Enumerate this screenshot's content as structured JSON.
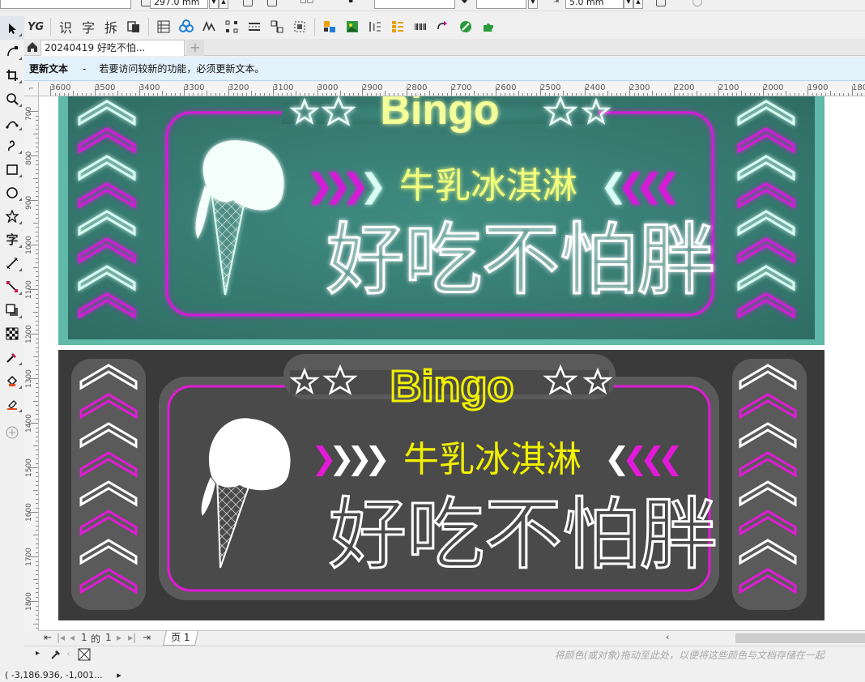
{
  "propbar": {
    "width_value": "297.0 mm",
    "nudge_value": "5.0 mm"
  },
  "toolbar": {
    "yg_label": "YG",
    "recognize_label": "识",
    "char_label": "字",
    "split_label": "拆"
  },
  "tools": [
    {
      "name": "pick-tool",
      "icon": "arrow-icon"
    },
    {
      "name": "shape-tool",
      "icon": "shape-icon"
    },
    {
      "name": "crop-tool",
      "icon": "crop-icon"
    },
    {
      "name": "zoom-tool",
      "icon": "magnifier-icon"
    },
    {
      "name": "freehand-tool",
      "icon": "freehand-icon"
    },
    {
      "name": "artistic-media-tool",
      "icon": "brush-icon"
    },
    {
      "name": "rectangle-tool",
      "icon": "rectangle-icon"
    },
    {
      "name": "ellipse-tool",
      "icon": "ellipse-icon"
    },
    {
      "name": "polygon-tool",
      "icon": "star-icon"
    },
    {
      "name": "text-tool",
      "icon": "text-icon",
      "label": "字"
    },
    {
      "name": "parallel-dimension-tool",
      "icon": "dimension-icon"
    },
    {
      "name": "connector-tool",
      "icon": "connector-icon"
    },
    {
      "name": "drop-shadow-tool",
      "icon": "shadow-icon"
    },
    {
      "name": "transparency-tool",
      "icon": "checker-icon"
    },
    {
      "name": "color-eyedropper-tool",
      "icon": "eyedropper-icon"
    },
    {
      "name": "interactive-fill-tool",
      "icon": "bucket-icon"
    },
    {
      "name": "smart-fill-tool",
      "icon": "smart-fill-icon"
    },
    {
      "name": "add-tool",
      "icon": "plus-circle-icon"
    }
  ],
  "document_tab": {
    "title": "20240419 好吃不怕...",
    "add_label": "+"
  },
  "infobar": {
    "title": "更新文本",
    "separator": "-",
    "message": "若要访问较新的功能，必须更新文本。"
  },
  "ruler": {
    "h_labels": [
      "3600",
      "3500",
      "3400",
      "3300",
      "3200",
      "3100",
      "3000",
      "2900",
      "2800",
      "2700",
      "2600",
      "2500",
      "2400",
      "2300",
      "2200",
      "2100",
      "2000",
      "1900",
      "180"
    ],
    "v_labels": [
      "700",
      "800",
      "900",
      "1000",
      "1100",
      "1200",
      "1300",
      "1400",
      "1500",
      "1600",
      "1700",
      "1800"
    ]
  },
  "artwork": {
    "top": {
      "bingo": "Bingo",
      "subtitle": "牛乳冰淇淋",
      "headline": "好吃不怕胖",
      "bg_color": "#3b8f83",
      "glow_color": "#7ef3d8"
    },
    "bottom": {
      "bingo": "Bingo",
      "subtitle": "牛乳冰淇淋",
      "headline": "好吃不怕胖",
      "bg_color": "#3a3a3a"
    },
    "colors": {
      "magenta": "#e21ad8",
      "yellow": "#f0f000",
      "white": "#ffffff"
    }
  },
  "pagebar": {
    "page_current": "1",
    "of_label": "的",
    "page_total": "1",
    "page_tab": "页 1"
  },
  "colorbar": {
    "hint": "将颜色(或对象)拖动至此处，以便将这些颜色与文档存储在一起"
  },
  "status": {
    "coords": "( -3,186.936, -1,001...",
    "arrow": "▸"
  }
}
